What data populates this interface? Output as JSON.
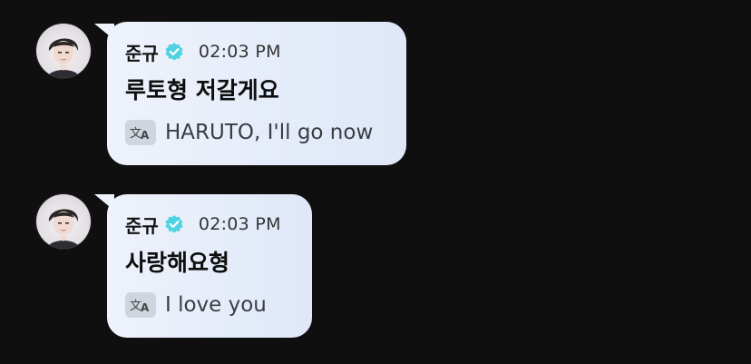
{
  "messages": [
    {
      "sender": "준규",
      "time": "02:03 PM",
      "text": "루토형 저갈게요",
      "translation": "HARUTO, I'll go now"
    },
    {
      "sender": "준규",
      "time": "02:03 PM",
      "text": "사랑해요형",
      "translation": "I love you"
    }
  ],
  "colors": {
    "background": "#0f0f10",
    "bubble": "#e6ecf8",
    "verified": "#4ed3e0"
  },
  "icons": {
    "verified": "verified-badge-icon",
    "translate": "translate-icon"
  }
}
